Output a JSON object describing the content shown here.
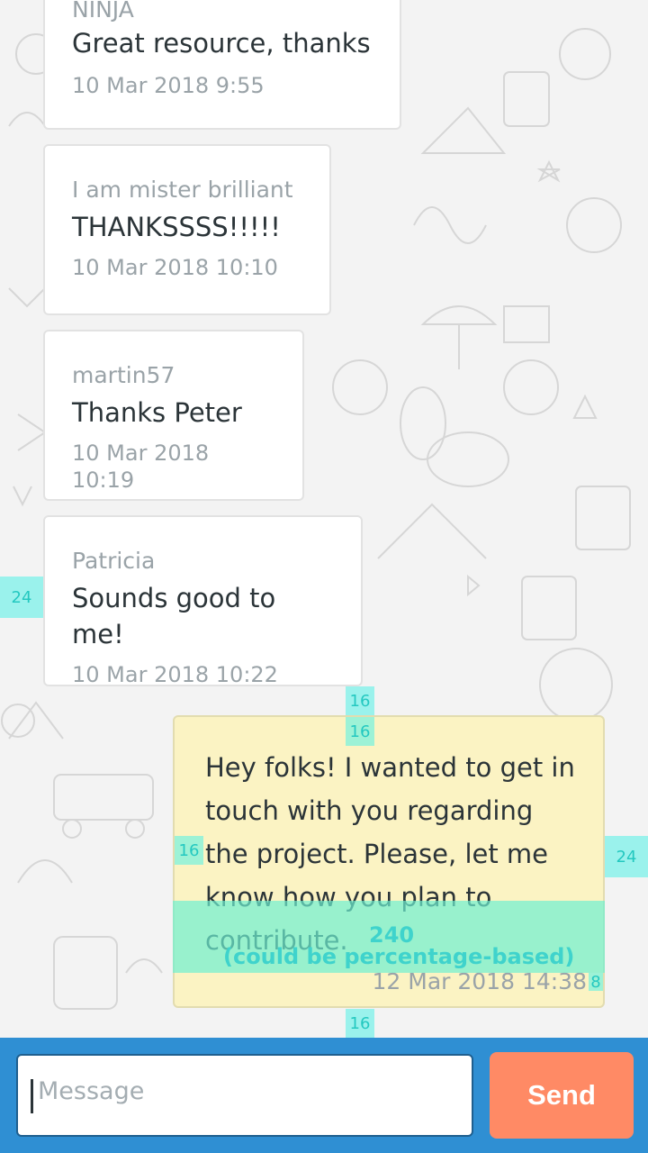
{
  "messages": [
    {
      "sender": "NINJA",
      "text": "Great resource, thanks",
      "time": "10 Mar 2018 9:55"
    },
    {
      "sender": "I am mister brilliant",
      "text": "THANKSSSS!!!!!",
      "time": "10 Mar 2018 10:10"
    },
    {
      "sender": "martin57",
      "text": "Thanks Peter",
      "time": "10 Mar 2018 10:19"
    },
    {
      "sender": "Patricia",
      "text": "Sounds good to me!",
      "time": "10 Mar 2018 10:22"
    }
  ],
  "own_message": {
    "text": "Hey folks! I wanted to get in touch with you regarding the project. Please, let me know how you plan to contribute.",
    "time": "12 Mar 2018 14:38"
  },
  "composer": {
    "placeholder": "Message",
    "send_label": "Send"
  },
  "spacing_guides": {
    "left_margin": "24",
    "gap_above": "16",
    "padding_top": "16",
    "padding_left": "16",
    "right_margin": "24",
    "width_label": "240",
    "width_note": "(could be percentage-based)",
    "gap_below": "16",
    "small": "8"
  },
  "colors": {
    "own_bubble": "#fbf3c3",
    "composer_bar": "#2f8fd3",
    "send_button": "#ff8a65",
    "guide": "#50f0e6"
  }
}
